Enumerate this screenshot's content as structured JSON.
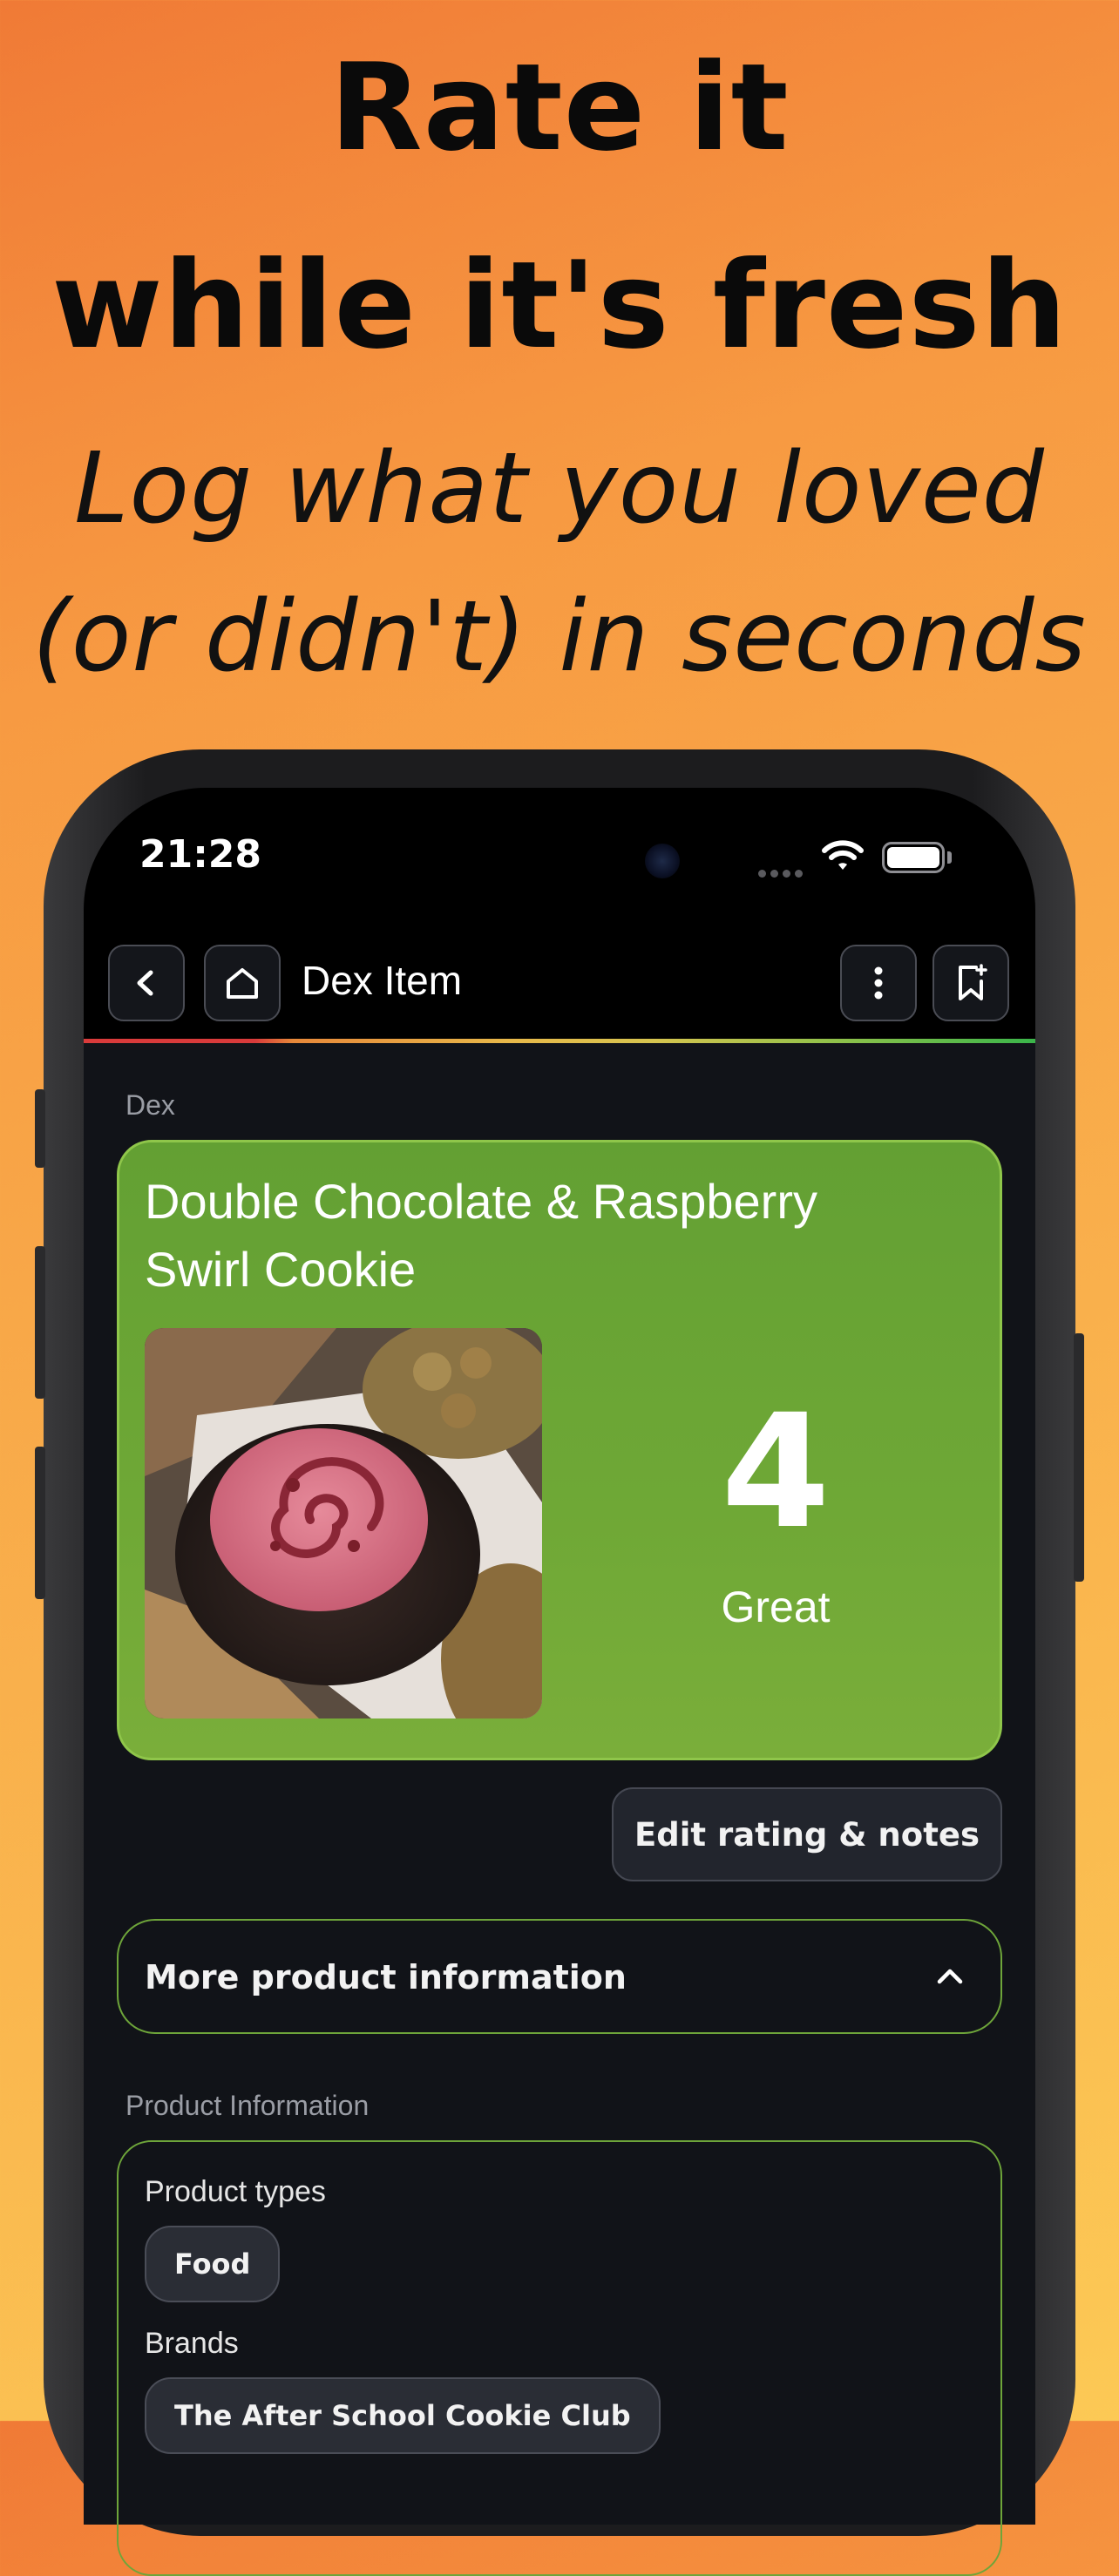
{
  "marketing": {
    "headline_line1": "Rate it",
    "headline_line2": "while it's fresh",
    "subline_line1": "Log what you loved",
    "subline_line2": "(or didn't) in seconds"
  },
  "status_bar": {
    "time": "21:28"
  },
  "nav": {
    "title": "Dex Item",
    "back_icon": "chevron-left-icon",
    "home_icon": "home-icon",
    "more_icon": "vertical-ellipsis-icon",
    "bookmark_icon": "bookmark-add-icon"
  },
  "dex": {
    "section_label": "Dex",
    "item_title": "Double Chocolate & Raspberry Swirl Cookie",
    "rating_value": "4",
    "rating_label": "Great",
    "card_color": "#6ba534"
  },
  "actions": {
    "edit_label": "Edit rating & notes"
  },
  "more_info": {
    "label": "More product information",
    "expanded": true
  },
  "product_info": {
    "section_label": "Product Information",
    "product_types_label": "Product types",
    "product_types": [
      "Food"
    ],
    "brands_label": "Brands",
    "brands": [
      "The After School Cookie Club"
    ]
  },
  "colors": {
    "accent_green": "#6ea53a",
    "background": "#111318"
  }
}
